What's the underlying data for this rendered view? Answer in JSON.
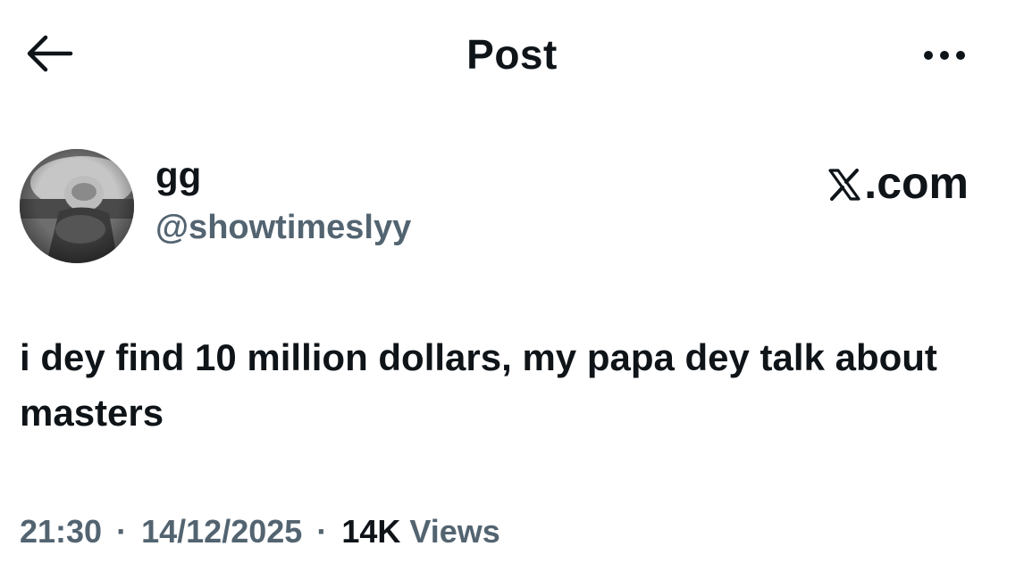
{
  "header": {
    "back_icon": "arrow-left-icon",
    "title": "Post",
    "more_icon": "more-horizontal-icon"
  },
  "author": {
    "display_name": "gg",
    "handle": "@showtimeslyy",
    "avatar": "avatar-photo"
  },
  "source": {
    "label": ".com",
    "logo": "x-logo-icon"
  },
  "post": {
    "text": "i dey find 10 million dollars, my papa dey talk about masters"
  },
  "meta": {
    "time": "21:30",
    "date": "14/12/2025",
    "separator": "·",
    "views_count": "14K",
    "views_label": "Views"
  },
  "colors": {
    "text": "#0f1419",
    "secondary": "#536471",
    "background": "#ffffff"
  }
}
